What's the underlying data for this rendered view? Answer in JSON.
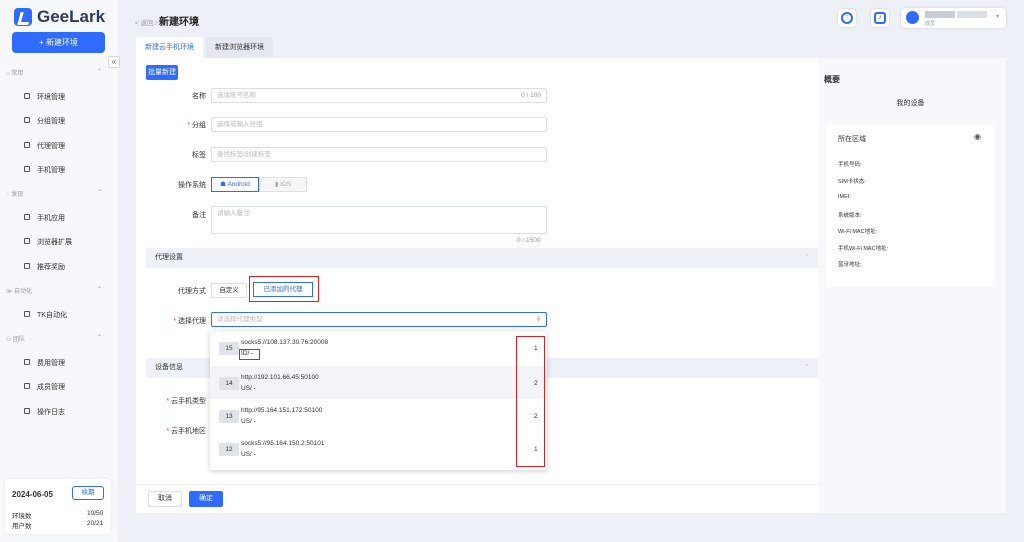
{
  "app": {
    "name": "GeeLark",
    "new_env_label": "+ 新建环境"
  },
  "sidebar": {
    "groups": [
      {
        "label": "常用",
        "items": [
          "环境管理",
          "分组管理",
          "代理管理",
          "手机管理"
        ]
      },
      {
        "label": "发现",
        "items": [
          "手机应用",
          "浏览器扩展",
          "推荐奖励"
        ]
      },
      {
        "label": "自动化",
        "items": [
          "TK自动化"
        ]
      },
      {
        "label": "团队",
        "items": [
          "费用管理",
          "成员管理",
          "操作日志"
        ]
      }
    ],
    "card": {
      "date": "2024-06-05",
      "renew": "续期",
      "env_label": "环境数",
      "env_value": "10/50",
      "user_label": "用户数",
      "user_value": "20/21"
    }
  },
  "header": {
    "back": "< 返回 /",
    "title": "新建环境",
    "user_role": "成员"
  },
  "tabs": [
    "新建云手机环境",
    "新建浏览器环境"
  ],
  "form": {
    "batch": "批量新建",
    "name_label": "名称",
    "name_placeholder": "选填账号名称",
    "name_counter": "0 / 100",
    "group_label": "分组",
    "group_placeholder": "选择或输入分组",
    "tag_label": "标签",
    "tag_placeholder": "查找标签/创建标签",
    "os_label": "操作系统",
    "os_android": "Android",
    "os_ios": "iOS",
    "note_label": "备注",
    "note_placeholder": "请输入备注",
    "note_counter": "0 / 1500",
    "proxy_section": "代理设置",
    "proxy_mode_label": "代理方式",
    "proxy_custom": "自定义",
    "proxy_added": "已添加的代理",
    "proxy_select_label": "选择代理",
    "proxy_select_placeholder": "请选择代理类型",
    "device_section": "设备信息",
    "phone_type_label": "云手机类型",
    "phone_region_label": "云手机地区"
  },
  "proxies": [
    {
      "id": "15",
      "url": "socks5://108.137.30.76:20008",
      "country": "ID/ -",
      "count": "1"
    },
    {
      "id": "14",
      "url": "http://192.101.66.45:50100",
      "country": "US/ -",
      "count": "2"
    },
    {
      "id": "13",
      "url": "http://95.164.151.172:50100",
      "country": "US/ -",
      "count": "2"
    },
    {
      "id": "12",
      "url": "socks5://95.164.150.2:50101",
      "country": "US/ -",
      "count": "1"
    }
  ],
  "summary": {
    "title": "概要",
    "subtitle": "我的设备",
    "region": "所在区域",
    "rows": [
      "手机号码:",
      "SIM卡状态:",
      "IMEI:",
      "系统版本:",
      "Wi-Fi MAC地址:",
      "手机Wi-Fi MAC地址:",
      "蓝牙地址:"
    ]
  },
  "footer": {
    "cancel": "取消",
    "ok": "确定"
  },
  "colors": {
    "accent": "#2f6bff",
    "highlight": "#e02020"
  }
}
